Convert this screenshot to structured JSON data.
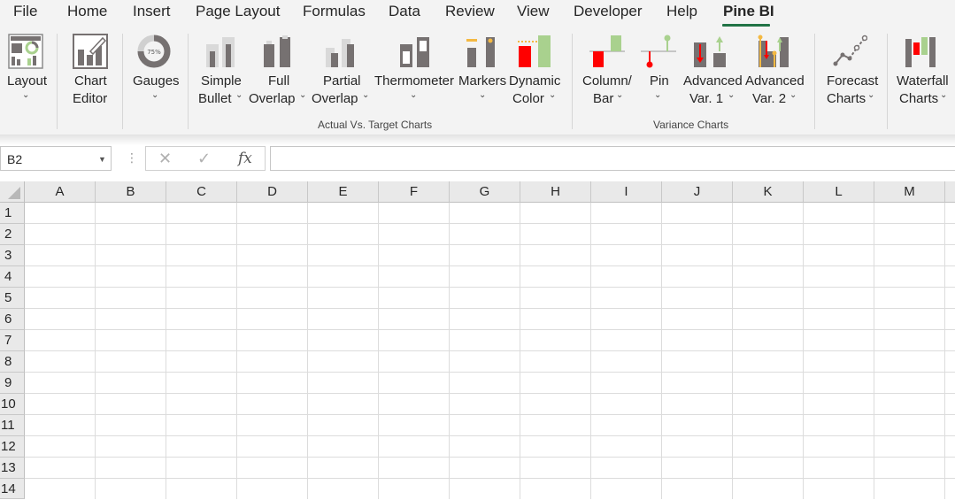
{
  "menu": {
    "tabs": [
      "File",
      "Home",
      "Insert",
      "Page Layout",
      "Formulas",
      "Data",
      "Review",
      "View",
      "Developer",
      "Help",
      "Pine BI"
    ],
    "active_tab": "Pine BI",
    "accent_color": "#217346"
  },
  "ribbon": {
    "buttons": {
      "layout": {
        "line1": "Layout",
        "chevron": "⌄"
      },
      "chart_editor": {
        "line1": "Chart",
        "line2": "Editor"
      },
      "gauges": {
        "line1": "Gauges",
        "chevron": "⌄",
        "icon_text": "75%"
      },
      "simple_bullet": {
        "line1": "Simple",
        "line2": "Bullet",
        "chevron": "⌄"
      },
      "full_overlap": {
        "line1": "Full",
        "line2": "Overlap",
        "chevron": "⌄"
      },
      "partial_overlap": {
        "line1": "Partial",
        "line2": "Overlap",
        "chevron": "⌄"
      },
      "thermometer": {
        "line1": "Thermometer",
        "chevron": "⌄"
      },
      "markers": {
        "line1": "Markers",
        "chevron": "⌄"
      },
      "dynamic_color": {
        "line1": "Dynamic",
        "line2": "Color",
        "chevron": "⌄"
      },
      "column_bar": {
        "line1": "Column/",
        "line2": "Bar",
        "chevron": "⌄"
      },
      "pin": {
        "line1": "Pin",
        "chevron": "⌄"
      },
      "advanced_var1": {
        "line1": "Advanced",
        "line2": "Var. 1",
        "chevron": "⌄"
      },
      "advanced_var2": {
        "line1": "Advanced",
        "line2": "Var. 2",
        "chevron": "⌄"
      },
      "forecast_charts": {
        "line1": "Forecast",
        "line2": "Charts",
        "chevron": "⌄"
      },
      "waterfall_charts": {
        "line1": "Waterfall",
        "line2": "Charts",
        "chevron": "⌄"
      }
    },
    "groups": {
      "actual_vs_target": "Actual Vs. Target Charts",
      "variance": "Variance Charts"
    },
    "colors": {
      "green": "#a9d18e",
      "red": "#ff0000",
      "gray": "#767171",
      "gold": "#f4b942"
    }
  },
  "formula_bar": {
    "name_box": "B2",
    "cancel_symbol": "✕",
    "enter_symbol": "✓",
    "fx_symbol": "fx",
    "formula": ""
  },
  "sheet": {
    "columns": [
      "A",
      "B",
      "C",
      "D",
      "E",
      "F",
      "G",
      "H",
      "I",
      "J",
      "K",
      "L",
      "M"
    ],
    "rows": [
      "1",
      "2",
      "3",
      "4",
      "5",
      "6",
      "7",
      "8",
      "9",
      "10",
      "11",
      "12",
      "13",
      "14"
    ]
  }
}
